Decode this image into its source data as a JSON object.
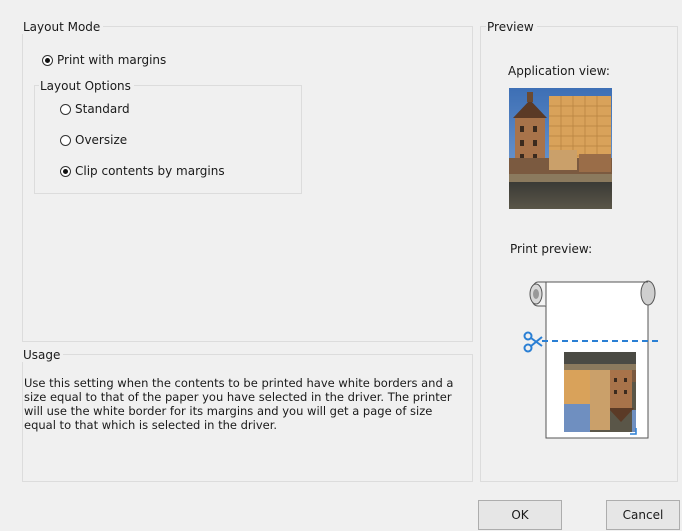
{
  "layout_mode": {
    "title": "Layout Mode",
    "print_with_margins": {
      "label": "Print with margins",
      "checked": true
    },
    "layout_options": {
      "title": "Layout Options",
      "options": [
        {
          "label": "Standard",
          "checked": false
        },
        {
          "label": "Oversize",
          "checked": false
        },
        {
          "label": "Clip contents by margins",
          "checked": true
        }
      ]
    }
  },
  "usage": {
    "title": "Usage",
    "text": "Use this setting when the contents to be printed have white borders and a size equal to that of the paper you have selected in the driver. The printer will use the white border for its margins and you will get a page of size equal to that which is selected in the driver."
  },
  "preview": {
    "title": "Preview",
    "application_view_label": "Application view:",
    "print_preview_label": "Print preview:"
  },
  "buttons": {
    "ok": "OK",
    "cancel": "Cancel"
  },
  "colors": {
    "accent_blue": "#2a7fd4",
    "window_bg": "#f0f0f0"
  }
}
